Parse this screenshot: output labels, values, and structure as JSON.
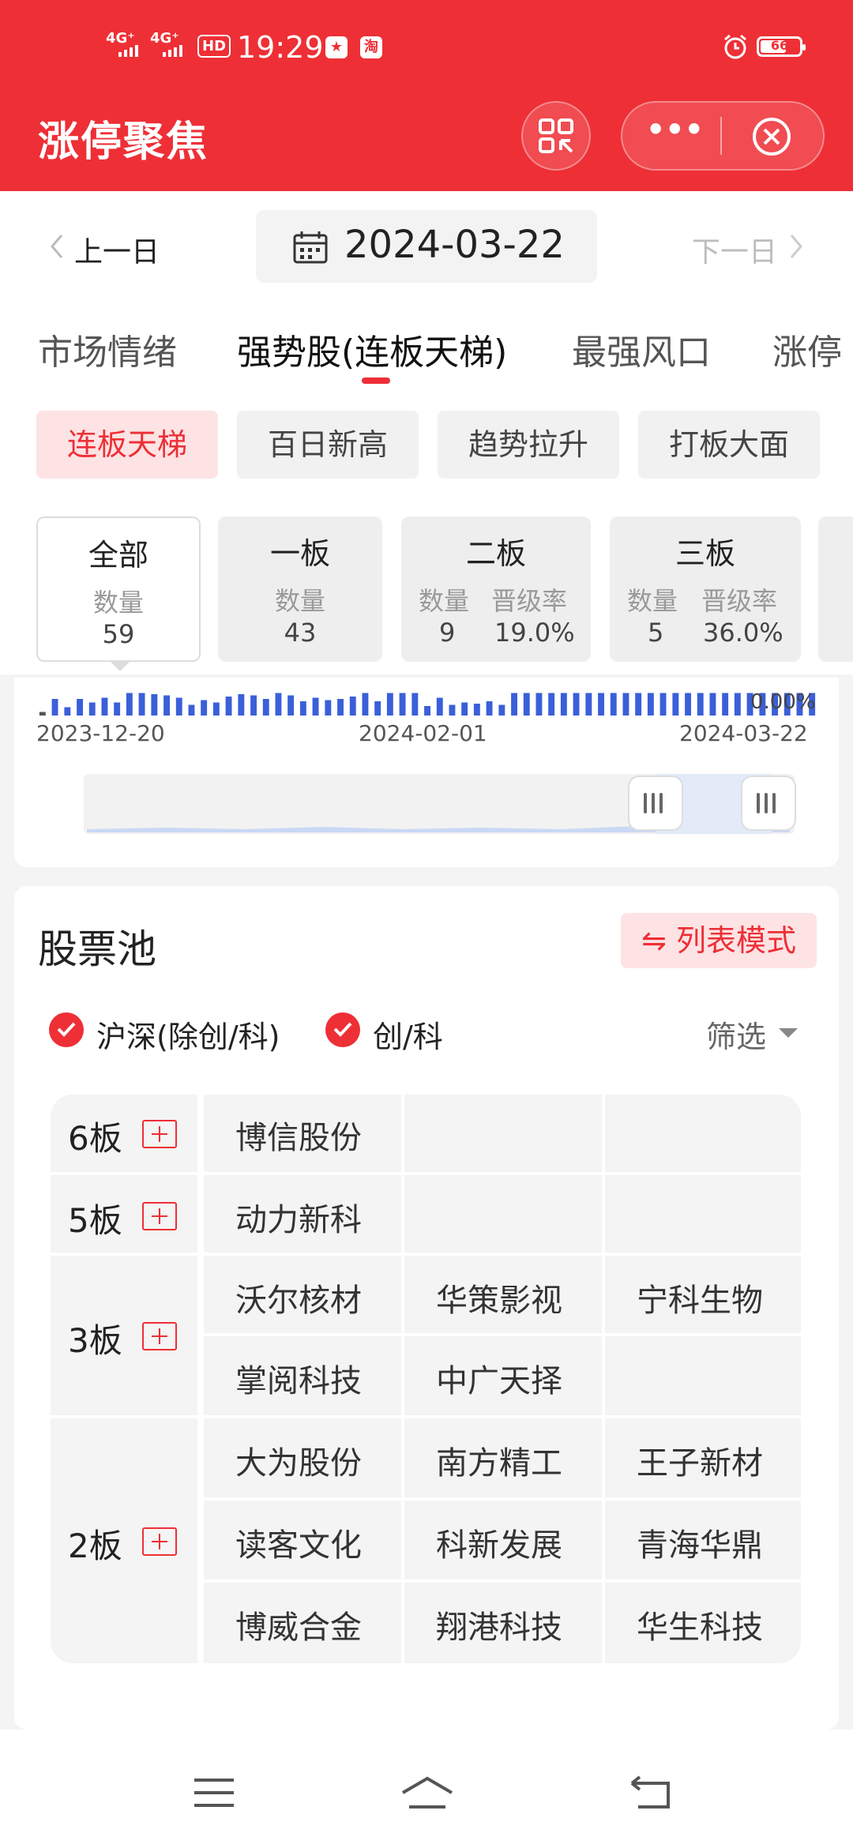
{
  "status_bar": {
    "signal1": "4G⁺",
    "signal2": "4G⁺",
    "hd": "HD",
    "time": "19:29",
    "battery": "66",
    "battery_percent": 66,
    "icons": [
      "mini-game-icon",
      "taobao-icon",
      "alarm-icon"
    ]
  },
  "header": {
    "title": "涨停聚焦",
    "capsule_more": "•••"
  },
  "date_nav": {
    "prev": "上一日",
    "date": "2024-03-22",
    "next": "下一日"
  },
  "tabs": [
    {
      "label": "市场情绪"
    },
    {
      "label": "强势股(连板天梯)",
      "active": true
    },
    {
      "label": "最强风口"
    },
    {
      "label": "涨停"
    }
  ],
  "chips": [
    {
      "label": "连板天梯",
      "active": true
    },
    {
      "label": "百日新高"
    },
    {
      "label": "趋势拉升"
    },
    {
      "label": "打板大面"
    }
  ],
  "cards": [
    {
      "title": "全部",
      "count_label": "数量",
      "count": "59",
      "active": true
    },
    {
      "title": "一板",
      "count_label": "数量",
      "count": "43"
    },
    {
      "title": "二板",
      "count_label": "数量",
      "count": "9",
      "rate_label": "晋级率",
      "rate": "19.0%"
    },
    {
      "title": "三板",
      "count_label": "数量",
      "count": "5",
      "rate_label": "晋级率",
      "rate": "36.0%"
    }
  ],
  "chart": {
    "value_label": "0.00%",
    "x_labels": [
      "2023-12-20",
      "2024-02-01",
      "2024-03-22"
    ]
  },
  "chart_data": {
    "type": "bar",
    "title": "",
    "xlabel": "",
    "ylabel": "",
    "x_start": "2023-12-20",
    "x_end": "2024-03-22",
    "values": [
      0.15,
      0.7,
      0.35,
      0.7,
      0.55,
      0.75,
      0.55,
      0.95,
      0.95,
      0.9,
      0.85,
      0.75,
      0.45,
      0.65,
      0.55,
      0.8,
      0.9,
      0.85,
      0.7,
      0.95,
      0.85,
      0.6,
      0.75,
      0.65,
      0.7,
      0.8,
      0.95,
      0.6,
      0.95,
      0.95,
      0.95,
      0.4,
      0.75,
      0.45,
      0.55,
      0.5,
      0.6,
      0.45,
      0.95,
      0.95,
      0.95,
      0.95,
      0.95,
      0.95,
      0.95,
      0.95,
      0.95,
      0.95,
      0.95,
      0.95,
      0.95,
      0.95,
      0.95,
      0.95,
      0.95,
      0.95,
      0.95,
      0.95,
      0.95,
      0.95,
      0.95,
      0.95,
      0.95
    ]
  },
  "pool": {
    "title": "股票池",
    "mode_button": "⇋ 列表模式",
    "filters": [
      {
        "label": "沪深(除创/科)",
        "checked": true
      },
      {
        "label": "创/科",
        "checked": true
      }
    ],
    "filter_label": "筛选",
    "boards": [
      {
        "label": "6板",
        "stocks": [
          "博信股份"
        ]
      },
      {
        "label": "5板",
        "stocks": [
          "动力新科"
        ]
      },
      {
        "label": "3板",
        "stocks": [
          "沃尔核材",
          "华策影视",
          "宁科生物",
          "掌阅科技",
          "中广天择"
        ]
      },
      {
        "label": "2板",
        "stocks": [
          "大为股份",
          "南方精工",
          "王子新材",
          "读客文化",
          "科新发展",
          "青海华鼎",
          "博威合金",
          "翔港科技",
          "华生科技"
        ]
      }
    ]
  },
  "bottom_nav": {
    "icons": [
      "menu-icon",
      "home-icon",
      "back-icon"
    ]
  }
}
